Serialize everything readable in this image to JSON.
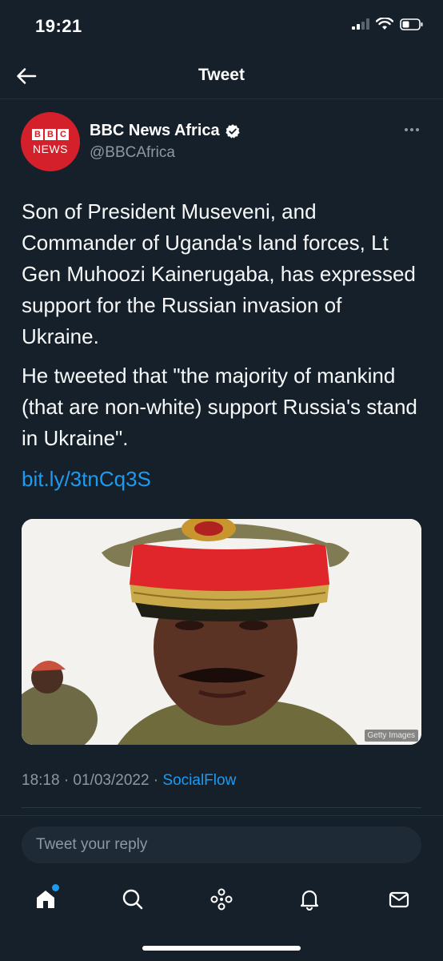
{
  "status_bar": {
    "time": "19:21"
  },
  "header": {
    "title": "Tweet"
  },
  "author": {
    "name": "BBC News Africa",
    "handle": "@BBCAfrica",
    "avatar_letters": [
      "B",
      "B",
      "C"
    ],
    "avatar_subtext": "NEWS",
    "verified": true
  },
  "tweet": {
    "paragraphs": [
      "Son of President Museveni, and Commander of Uganda's land forces, Lt Gen Muhoozi Kainerugaba, has expressed support for the Russian invasion of Ukraine.",
      "He tweeted that \"the majority of mankind (that are non-white) support Russia's stand in Ukraine\"."
    ],
    "link": "bit.ly/3tnCq3S",
    "media_credit": "Getty Images",
    "timestamp": "18:18 · 01/03/2022 · ",
    "source": "SocialFlow"
  },
  "reply": {
    "placeholder": "Tweet your reply"
  },
  "nav": [
    "home-icon",
    "search-icon",
    "spaces-icon",
    "notifications-icon",
    "messages-icon"
  ],
  "colors": {
    "background": "#15202b",
    "accent": "#1d9bf0",
    "secondary_text": "#8b98a5",
    "bbc_red": "#d4202a"
  }
}
